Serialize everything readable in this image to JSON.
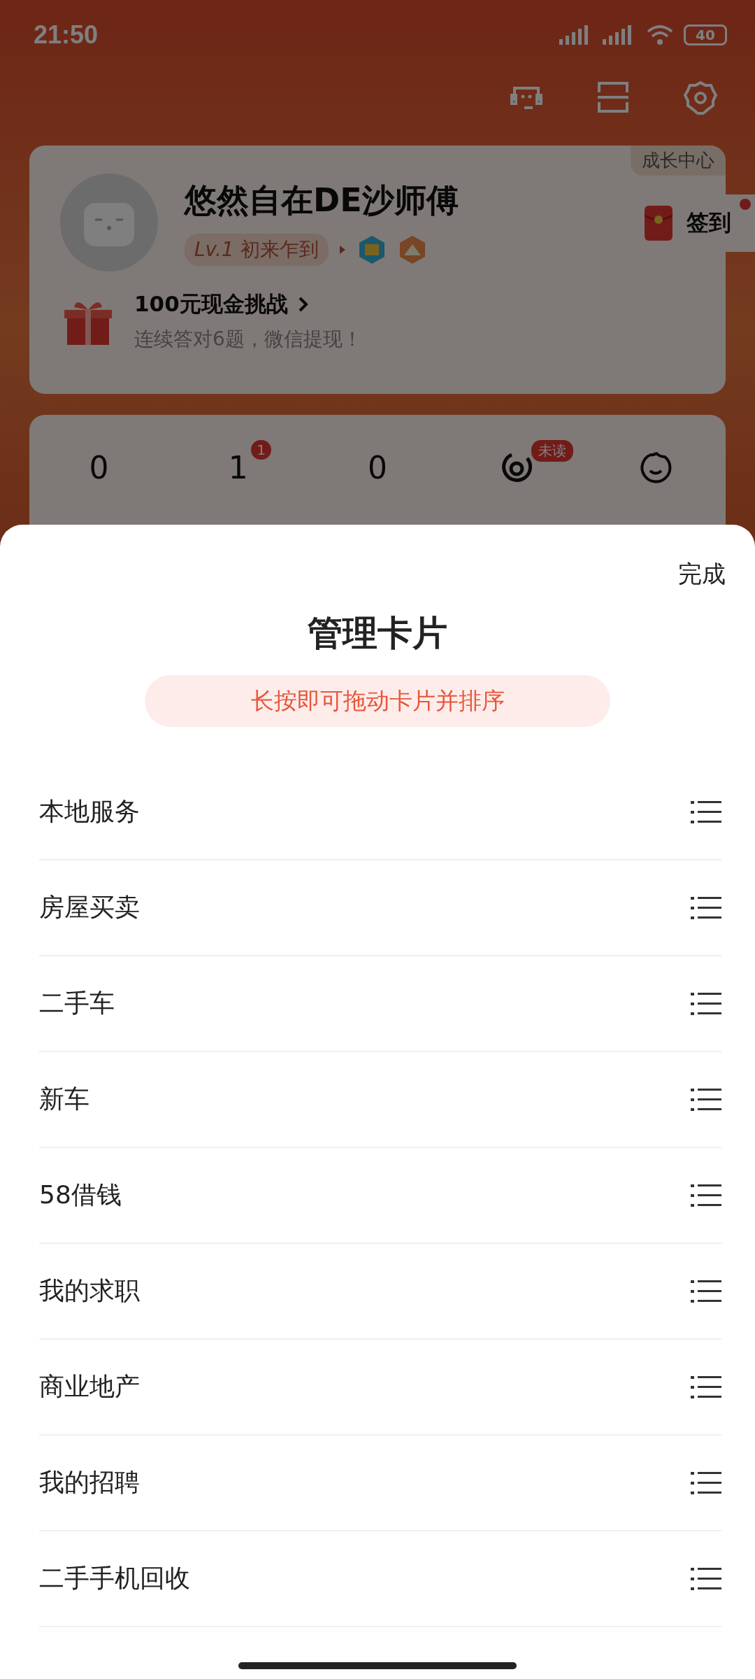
{
  "status_bar": {
    "time": "21:50",
    "battery": "40"
  },
  "profile": {
    "growth_center": "成长中心",
    "name": "悠然自在DE沙师傅",
    "level": "Lv.1",
    "level_title": "初来乍到",
    "checkin": "签到"
  },
  "challenge": {
    "title": "100元现金挑战",
    "subtitle": "连续答对6题，微信提现！"
  },
  "stats": [
    {
      "kind": "count",
      "value": "0"
    },
    {
      "kind": "count",
      "value": "1",
      "badge": "1"
    },
    {
      "kind": "count",
      "value": "0"
    },
    {
      "kind": "ring",
      "badge": "未读"
    },
    {
      "kind": "face"
    }
  ],
  "sheet": {
    "done": "完成",
    "title": "管理卡片",
    "hint": "长按即可拖动卡片并排序",
    "cards": [
      {
        "name": "本地服务"
      },
      {
        "name": "房屋买卖"
      },
      {
        "name": "二手车"
      },
      {
        "name": "新车"
      },
      {
        "name": "58借钱"
      },
      {
        "name": "我的求职"
      },
      {
        "name": "商业地产"
      },
      {
        "name": "我的招聘"
      },
      {
        "name": "二手手机回收"
      }
    ]
  }
}
